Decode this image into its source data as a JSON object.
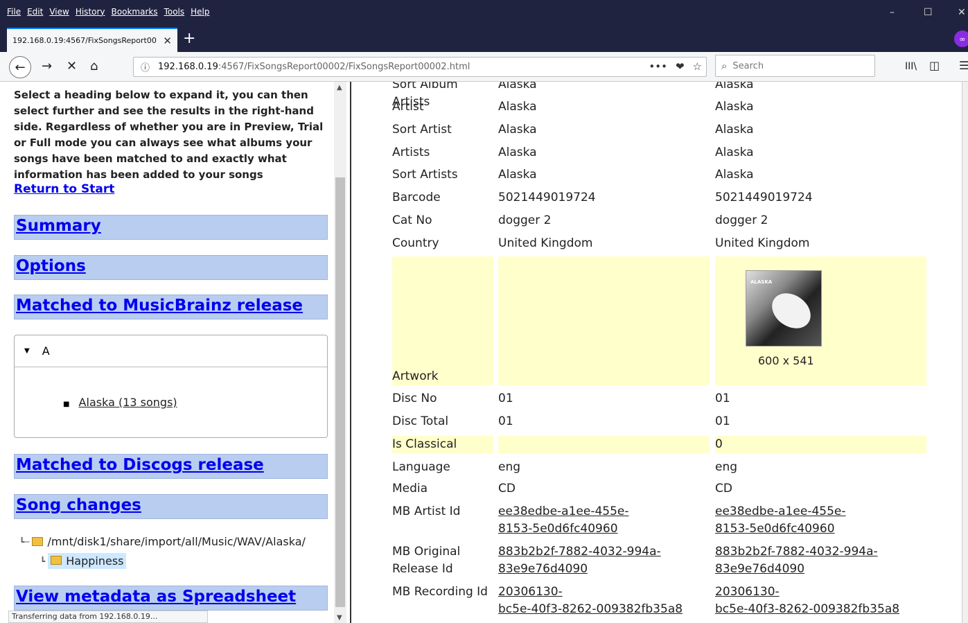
{
  "menu": [
    "File",
    "Edit",
    "View",
    "History",
    "Bookmarks",
    "Tools",
    "Help"
  ],
  "window_controls": {
    "minimize": "–",
    "maximize": "☐",
    "close": "✕"
  },
  "tab": {
    "title": "192.168.0.19:4567/FixSongsReport00",
    "close": "✕",
    "new": "+"
  },
  "nav": {
    "url_host": "192.168.0.19",
    "url_path": ":4567/FixSongsReport00002/FixSongsReport00002.html",
    "search_placeholder": "Search",
    "back": "←",
    "forward": "→",
    "stop": "✕",
    "home": "⌂",
    "more": "•••",
    "pocket": "❤",
    "star": "☆",
    "library": "III\\",
    "sidebar": "◫",
    "menu": "☰",
    "info": "ⓘ",
    "search_icon": "⌕"
  },
  "left": {
    "intro": "Select a heading below to expand it, you can then select further and see the results in the right-hand side. Regardless of whether you are in Preview, Trial or Full mode you can always see what albums your songs have been matched to and exactly what information has been added to your songs",
    "return_link": "Return to Start",
    "sections": {
      "summary": "Summary",
      "options": "Options",
      "musicbrainz": "Matched to MusicBrainz release",
      "discogs": "Matched to Discogs release",
      "song_changes": "Song changes",
      "spreadsheet": "View metadata as Spreadsheet"
    },
    "tree": {
      "group": "A",
      "item": "Alaska (13 songs)"
    },
    "folders": {
      "root": "/mnt/disk1/share/import/all/Music/WAV/Alaska/",
      "child": "Happiness"
    }
  },
  "status": "Transferring data from 192.168.0.19...",
  "rows": [
    {
      "label": "Sort Album Artists",
      "old": "Alaska",
      "new": "Alaska"
    },
    {
      "label": "Artist",
      "old": "Alaska",
      "new": "Alaska"
    },
    {
      "label": "Sort Artist",
      "old": "Alaska",
      "new": "Alaska"
    },
    {
      "label": "Artists",
      "old": "Alaska",
      "new": "Alaska"
    },
    {
      "label": "Sort Artists",
      "old": "Alaska",
      "new": "Alaska"
    },
    {
      "label": "Barcode",
      "old": "5021449019724",
      "new": "5021449019724"
    },
    {
      "label": "Cat No",
      "old": "dogger 2",
      "new": "dogger 2"
    },
    {
      "label": "Country",
      "old": "United Kingdom",
      "new": "United Kingdom"
    }
  ],
  "artwork": {
    "label": "Artwork",
    "dims": "600 x 541",
    "cover_text": "ALASKA"
  },
  "rows2": [
    {
      "label": "Disc No",
      "old": "01",
      "new": "01"
    },
    {
      "label": "Disc Total",
      "old": "01",
      "new": "01"
    },
    {
      "label": "Is Classical",
      "old": "",
      "new": "0"
    },
    {
      "label": "Language",
      "old": "eng",
      "new": "eng"
    },
    {
      "label": "Media",
      "old": "CD",
      "new": "CD"
    }
  ],
  "ids": {
    "artist": {
      "label": "MB Artist Id",
      "line1": "ee38edbe-a1ee-455e-",
      "line2": "8153-5e0d6fc40960"
    },
    "release": {
      "label1": "MB Original",
      "label2": "Release Id",
      "line1": "883b2b2f-7882-4032-994a-",
      "line2": "83e9e76d4090"
    },
    "recording": {
      "label": "MB Recording Id",
      "line1": "20306130-",
      "line2": "bc5e-40f3-8262-009382fb35a8"
    }
  }
}
